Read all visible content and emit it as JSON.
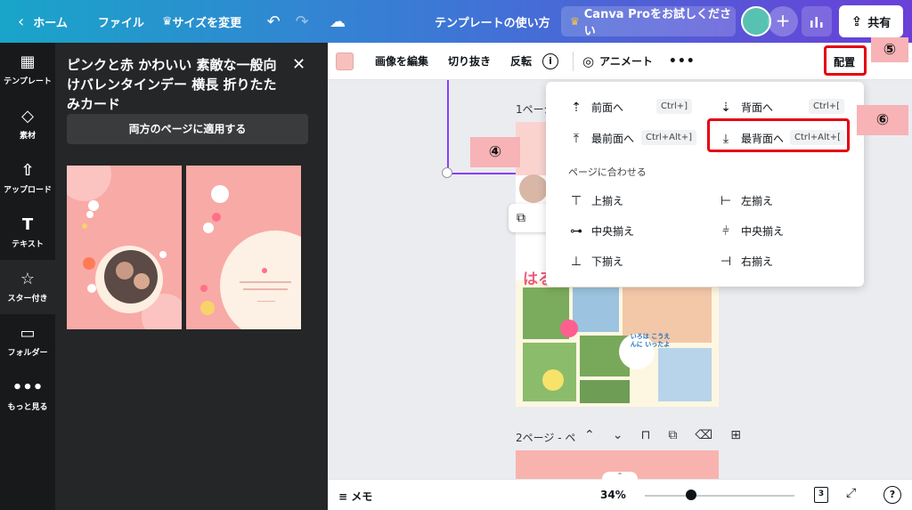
{
  "topbar": {
    "home_label": "ホーム",
    "file_label": "ファイル",
    "resize_label": "サイズを変更",
    "doc_title": "テンプレートの使い方",
    "pro_label": "Canva Proをお試しください",
    "share_label": "共有"
  },
  "rail": {
    "items": [
      {
        "label": "テンプレート",
        "icon": "template-icon"
      },
      {
        "label": "素材",
        "icon": "elements-icon"
      },
      {
        "label": "アップロード",
        "icon": "upload-icon"
      },
      {
        "label": "テキスト",
        "icon": "text-icon"
      },
      {
        "label": "スター付き",
        "icon": "star-icon"
      },
      {
        "label": "フォルダー",
        "icon": "folder-icon"
      },
      {
        "label": "もっと見る",
        "icon": "more-icon"
      }
    ]
  },
  "panel": {
    "title": "ピンクと赤 かわいい 素敵な一般向けバレンタインデー 横長 折りたたみカード",
    "apply_both_label": "両方のページに適用する"
  },
  "context_toolbar": {
    "edit_image": "画像を編集",
    "crop": "切り抜き",
    "flip": "反転",
    "info": "i",
    "animate": "アニメート",
    "more": "•••",
    "arrange": "配置"
  },
  "canvas": {
    "page1_label": "1ページ",
    "page1_heading": "はる",
    "page2_label": "2ページ - ペ",
    "photo_caption": "いろは こうえんに いったよ"
  },
  "annotations": {
    "step4": "④",
    "step5": "⑤",
    "step6": "⑥",
    "color": "#e50012"
  },
  "arrange_menu": {
    "forward": "前面へ",
    "forward_key": "Ctrl+]",
    "backward": "背面へ",
    "backward_key": "Ctrl+[",
    "to_front": "最前面へ",
    "to_front_key": "Ctrl+Alt+]",
    "to_back": "最背面へ",
    "to_back_key": "Ctrl+Alt+[",
    "align_section": "ページに合わせる",
    "align_top": "上揃え",
    "align_left": "左揃え",
    "align_middle": "中央揃え",
    "align_center": "中央揃え",
    "align_bottom": "下揃え",
    "align_right": "右揃え"
  },
  "bottombar": {
    "memo": "メモ",
    "zoom": "34%",
    "zoom_level": 0.34,
    "page_count": "3"
  }
}
